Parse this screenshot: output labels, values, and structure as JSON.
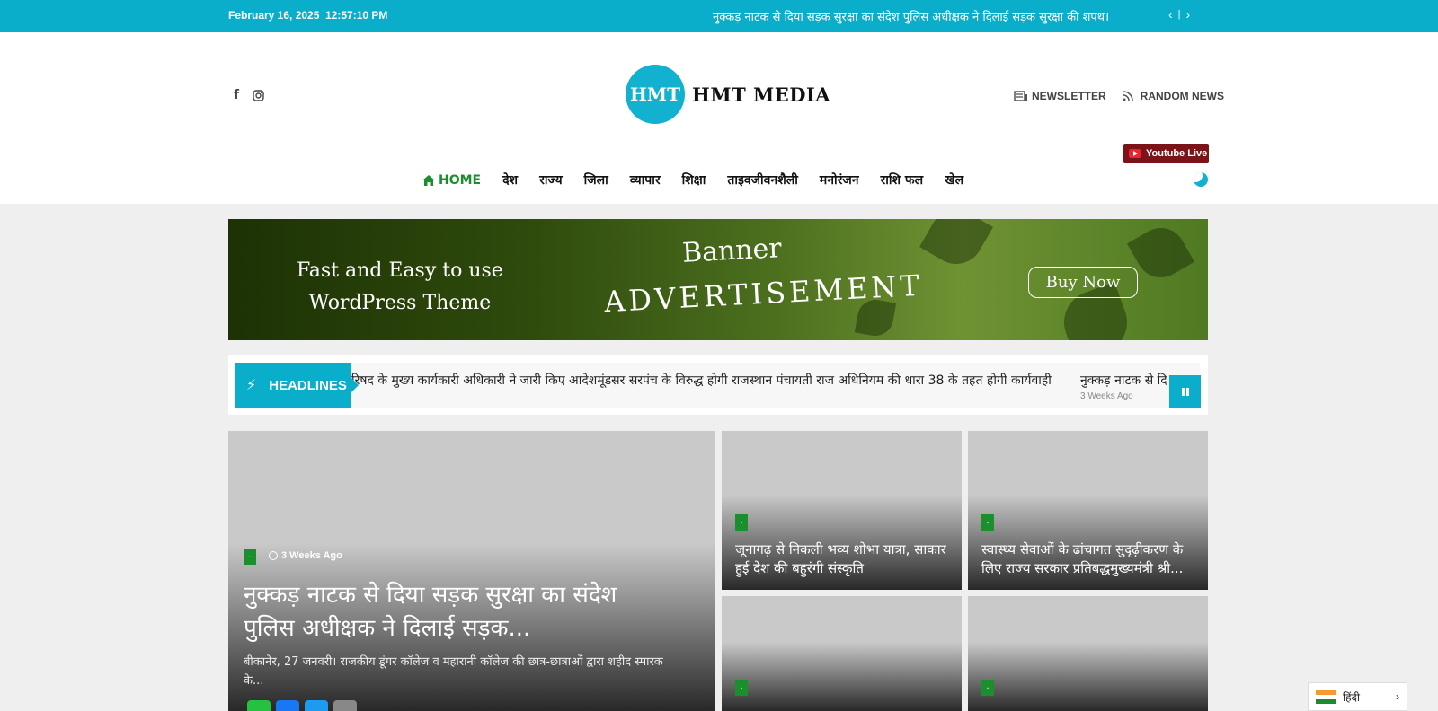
{
  "topbar": {
    "date": "February 16, 2025",
    "time": "12:57:10 PM",
    "ticker": "नुक्कड़ नाटक से दिया सड़क सुरक्षा का संदेश पुलिस अधीक्षक ने दिलाई सड़क सुरक्षा की शपथ।",
    "prev": "‹",
    "sep": "|",
    "next": "›"
  },
  "header": {
    "logo_mark": "HMT",
    "logo_text": "HMT MEDIA",
    "newsletter": "NEWSLETTER",
    "random_news": "RANDOM NEWS",
    "youtube_live": "Youtube Live"
  },
  "nav": {
    "items": [
      "HOME",
      "देश",
      "राज्य",
      "जिला",
      "व्यापार",
      "शिक्षा",
      "ताइवजीवनशैली",
      "मनोरंजन",
      "राशि फल",
      "खेल"
    ]
  },
  "banner": {
    "left_line1": "Fast and Easy to use",
    "left_line2": "WordPress Theme",
    "top": "Banner",
    "main": "ADVERTISEMENT",
    "button": "Buy Now"
  },
  "headlines": {
    "label": "HEADLINES",
    "ticker1": "रिषद के मुख्य कार्यकारी अधिकारी ने जारी किए आदेशमूंडसर सरपंच के विरुद्ध होगी राजस्थान पंचायती राज अधिनियम की धारा 38 के तहत होगी कार्यवाही",
    "ticker2": "नुक्कड़ नाटक से दि",
    "ticker2_ago": "3 Weeks Ago"
  },
  "posts": {
    "big": {
      "category": ".",
      "ago": "3 Weeks Ago",
      "title": "नुक्कड़ नाटक से दिया सड़क सुरक्षा का संदेश पुलिस अधीक्षक ने दिलाई सड़क...",
      "excerpt": "बीकानेर, 27 जनवरी। राजकीय डूंगर कॉलेज व महारानी कॉलेज की छात्र-छात्राओं द्वारा शहीद स्मारक के..."
    },
    "p1": {
      "category": ".",
      "title": "जूनागढ़ से निकली भव्य शोभा यात्रा, साकार हुई देश की बहुरंगी संस्कृति"
    },
    "p2": {
      "category": ".",
      "title": "स्वास्थ्य सेवाओं के ढांचागत सुदृढ़ीकरण के लिए राज्य सरकार प्रतिबद्धमुख्यमंत्री श्री..."
    },
    "p3": {
      "category": "."
    },
    "p4": {
      "category": "."
    }
  },
  "language": {
    "label": "हिंदी"
  },
  "colors": {
    "accent": "#0aaecb",
    "category": "#1b8f2d",
    "youtube": "#7a1418"
  }
}
